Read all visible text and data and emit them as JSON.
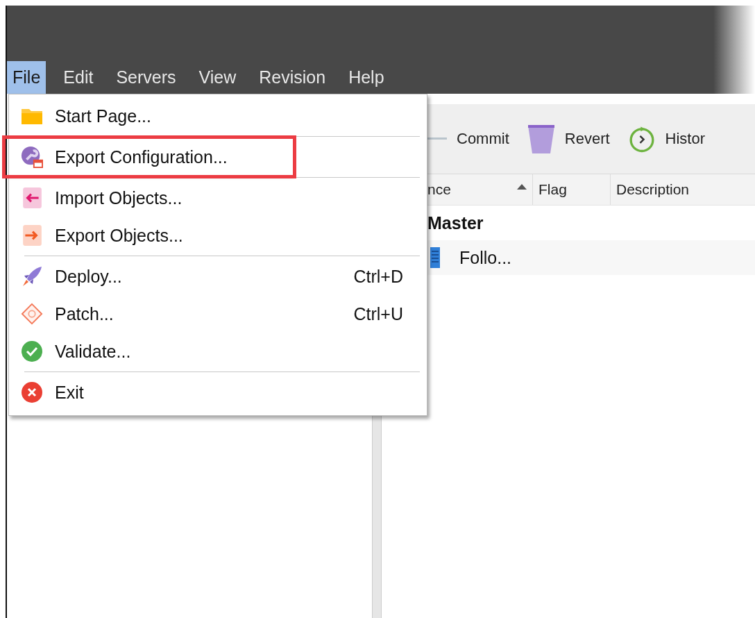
{
  "menu_bar": [
    {
      "label": "File",
      "selected": true
    },
    {
      "label": "Edit",
      "selected": false
    },
    {
      "label": "Servers",
      "selected": false
    },
    {
      "label": "View",
      "selected": false
    },
    {
      "label": "Revision",
      "selected": false
    },
    {
      "label": "Help",
      "selected": false
    }
  ],
  "file_menu": [
    {
      "kind": "item",
      "label": "Start Page...",
      "highlighted": false
    },
    {
      "kind": "separator"
    },
    {
      "kind": "item",
      "label": "Export Configuration...",
      "highlighted": true
    },
    {
      "kind": "separator"
    },
    {
      "kind": "item",
      "label": "Import Objects...",
      "highlighted": false
    },
    {
      "kind": "item",
      "label": "Export Objects...",
      "highlighted": false
    },
    {
      "kind": "separator"
    },
    {
      "kind": "item",
      "label": "Deploy...",
      "shortcut": "Ctrl+D",
      "highlighted": false
    },
    {
      "kind": "item",
      "label": "Patch...",
      "shortcut": "Ctrl+U",
      "highlighted": false
    },
    {
      "kind": "item",
      "label": "Validate...",
      "highlighted": false
    },
    {
      "kind": "separator"
    },
    {
      "kind": "item",
      "label": "Exit",
      "highlighted": false
    }
  ],
  "toolbar": [
    {
      "label": "Commit"
    },
    {
      "label": "Revert"
    },
    {
      "label": "Histor"
    }
  ],
  "table": {
    "columns": [
      {
        "label": "nce",
        "sorted": true
      },
      {
        "label": "Flag",
        "sorted": false
      },
      {
        "label": "Description",
        "sorted": false
      }
    ],
    "rows": [
      {
        "kind": "group",
        "label": "Master"
      },
      {
        "kind": "item",
        "label": "Follo..."
      }
    ]
  }
}
